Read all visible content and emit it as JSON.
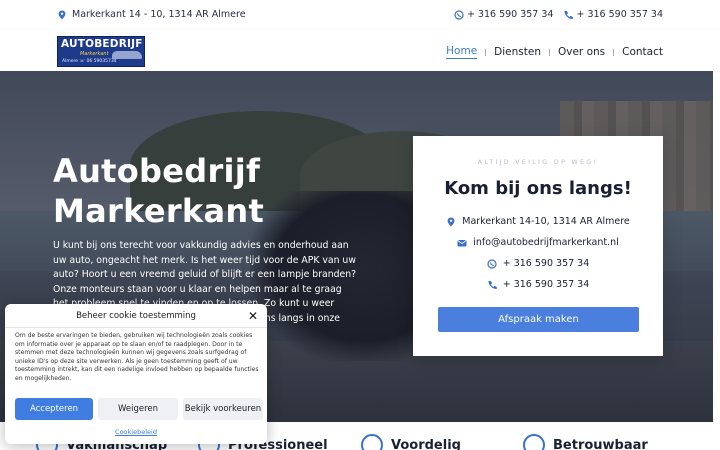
{
  "topbar": {
    "address": "Markerkant 14 - 10, 1314 AR Almere",
    "whatsapp": "+ 316 590 357 34",
    "phone": "+ 316 590 357 34"
  },
  "logo": {
    "name": "AUTOBEDRIJF",
    "sub": "Markerkant",
    "line": "Almere  ☏ 06 59035734"
  },
  "nav": {
    "items": [
      "Home",
      "Diensten",
      "Over ons",
      "Contact"
    ],
    "active": "Home"
  },
  "hero": {
    "title": "Autobedrijf Markerkant",
    "intro": "U kunt bij ons terecht voor vakkundig advies en onderhoud aan uw auto, ongeacht het merk. Is het weer tijd voor de APK van uw auto? Hoort u een vreemd geluid of blijft er een lampje branden? Onze monteurs staan voor u klaar en helpen maar al te graag het probleem snel te vinden en op te lossen. Zo kunt u weer veilig en zorgeloos de weg op. Kom gerust eens langs in onze werkplaats en maak kennis met ons team."
  },
  "card": {
    "tagline": "ALTIJD VEILIG OP WEG!",
    "title": "Kom bij ons langs!",
    "address": "Markerkant 14-10, 1314 AR Almere",
    "email": "info@autobedrijfmarkerkant.nl",
    "whatsapp": "+ 316 590 357 34",
    "phone": "+ 316 590 357 34",
    "button": "Afspraak maken"
  },
  "features": [
    "Vakmanschap",
    "Professioneel",
    "Voordelig",
    "Betrouwbaar"
  ],
  "cookie": {
    "title": "Beheer cookie toestemming",
    "text": "Om de beste ervaringen te bieden, gebruiken wij technologieën zoals cookies om informatie over je apparaat op te slaan en/of te raadplegen. Door in te stemmen met deze technologieën kunnen wij gegevens zoals surfgedrag of unieke ID's op deze site verwerken. Als je geen toestemming geeft of uw toestemming intrekt, kan dit een nadelige invloed hebben op bepaalde functies en mogelijkheden.",
    "accept": "Accepteren",
    "deny": "Weigeren",
    "prefs": "Bekijk voorkeuren",
    "policy": "Cookiebeleid"
  },
  "colors": {
    "accent": "#4a7fde",
    "text": "#1a2033"
  }
}
